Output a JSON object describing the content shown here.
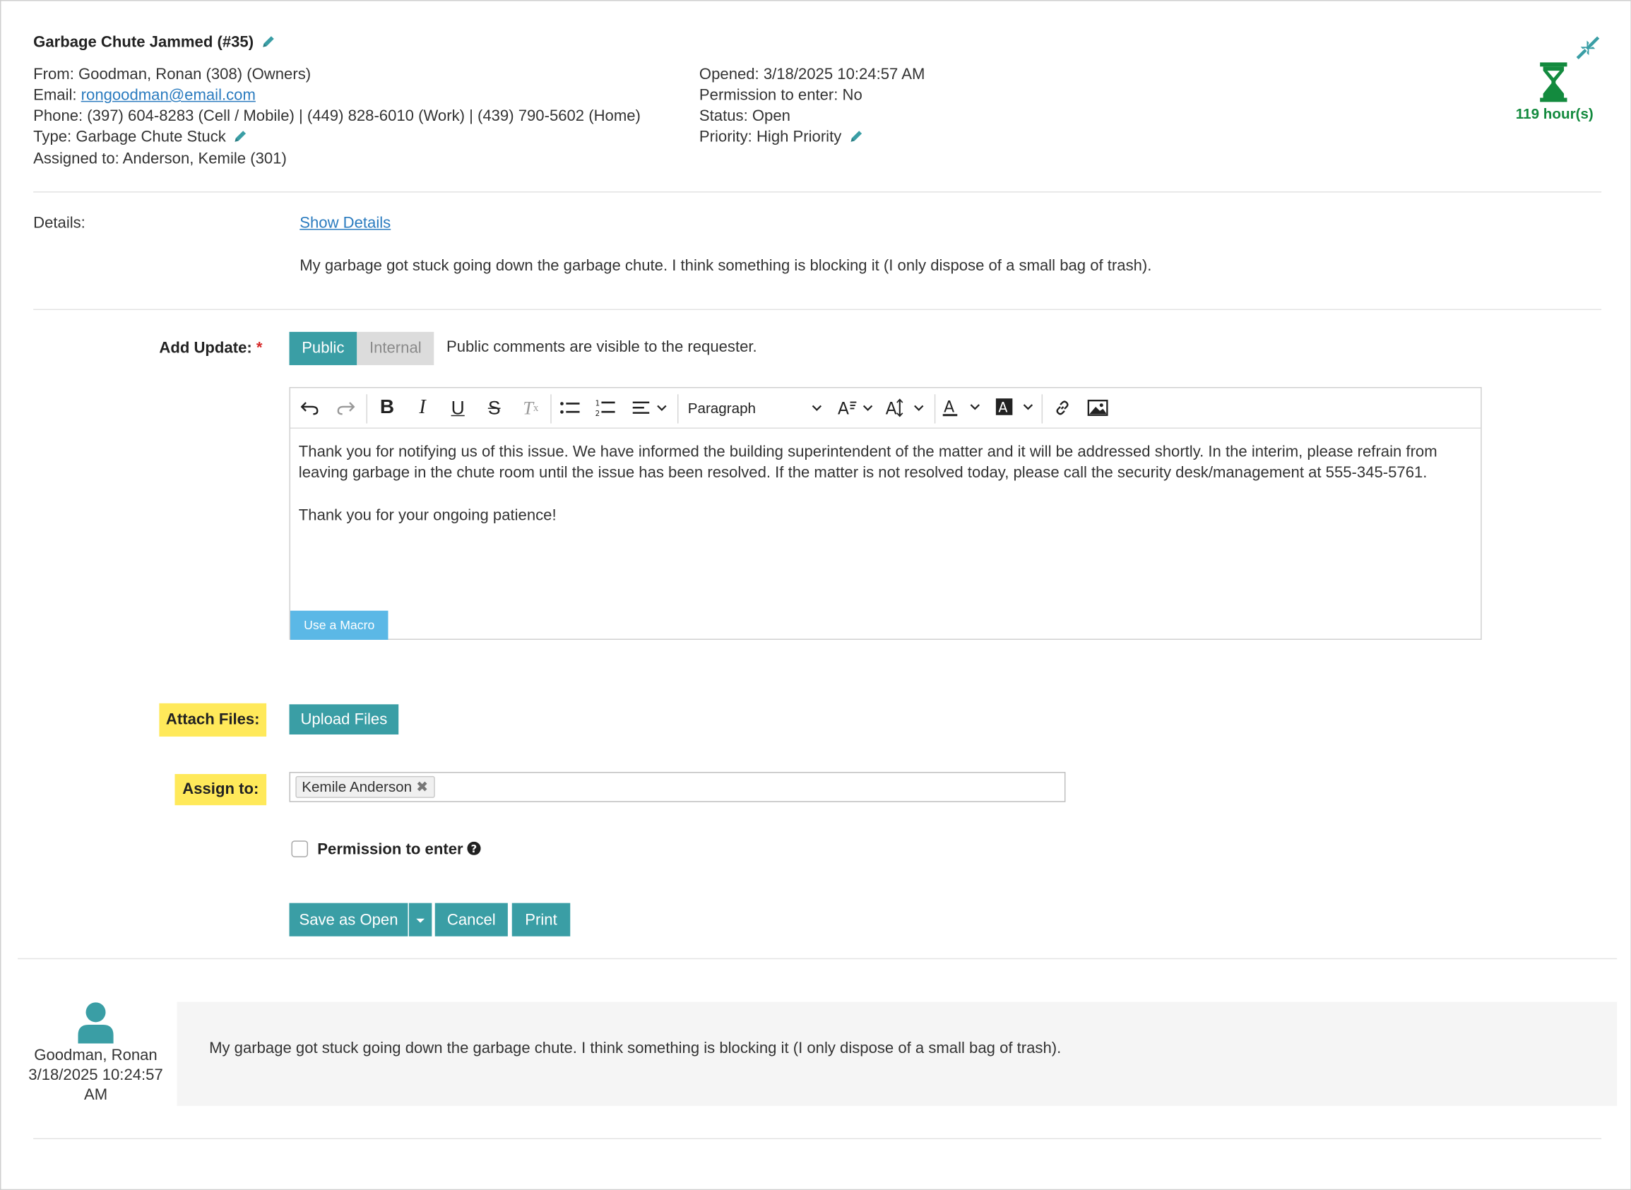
{
  "ticket": {
    "title": "Garbage Chute Jammed (#35)",
    "from": "From: Goodman, Ronan (308) (Owners)",
    "email_label": "Email: ",
    "email": "rongoodman@email.com",
    "phone": "Phone: (397) 604-8283 (Cell / Mobile) | (449) 828-6010 (Work) | (439) 790-5602 (Home)",
    "type": "Type: Garbage Chute Stuck",
    "assigned": "Assigned to: Anderson, Kemile (301)",
    "opened": "Opened: 3/18/2025 10:24:57 AM",
    "permission": "Permission to enter: No",
    "status": "Status: Open",
    "priority": "Priority: High Priority",
    "timer": "119 hour(s)"
  },
  "details": {
    "label": "Details:",
    "show_link": "Show Details",
    "text": "My garbage got stuck going down the garbage chute. I think something is blocking it (I only dispose of a small bag of trash)."
  },
  "update": {
    "label": "Add Update:",
    "required_mark": "*",
    "public_label": "Public",
    "internal_label": "Internal",
    "hint": "Public comments are visible to the requester.",
    "paragraph_select": "Paragraph",
    "body_p1": "Thank you for notifying us of this issue. We have informed the building superintendent of the matter and it will be addressed shortly. In the interim, please refrain from leaving garbage in the chute room until the issue has been resolved. If the matter is not resolved today, please call the security desk/management at 555-345-5761.",
    "body_p2": "Thank you for your ongoing patience!",
    "macro_label": "Use a Macro"
  },
  "attach": {
    "label": "Attach Files:",
    "button": "Upload Files"
  },
  "assign": {
    "label": "Assign to:",
    "tag": "Kemile Anderson"
  },
  "permission_checkbox": {
    "label": "Permission to enter",
    "checked": false
  },
  "actions": {
    "save": "Save as Open",
    "cancel": "Cancel",
    "print": "Print"
  },
  "history": {
    "author": "Goodman, Ronan",
    "date": "3/18/2025 10:24:57",
    "time": "AM",
    "text": "My garbage got stuck going down the garbage chute. I think something is blocking it (I only dispose of a small bag of trash)."
  },
  "colors": {
    "teal": "#3a9ea5",
    "timer_green": "#138a3e",
    "highlight": "#ffe95a",
    "link": "#2a7bbf"
  }
}
